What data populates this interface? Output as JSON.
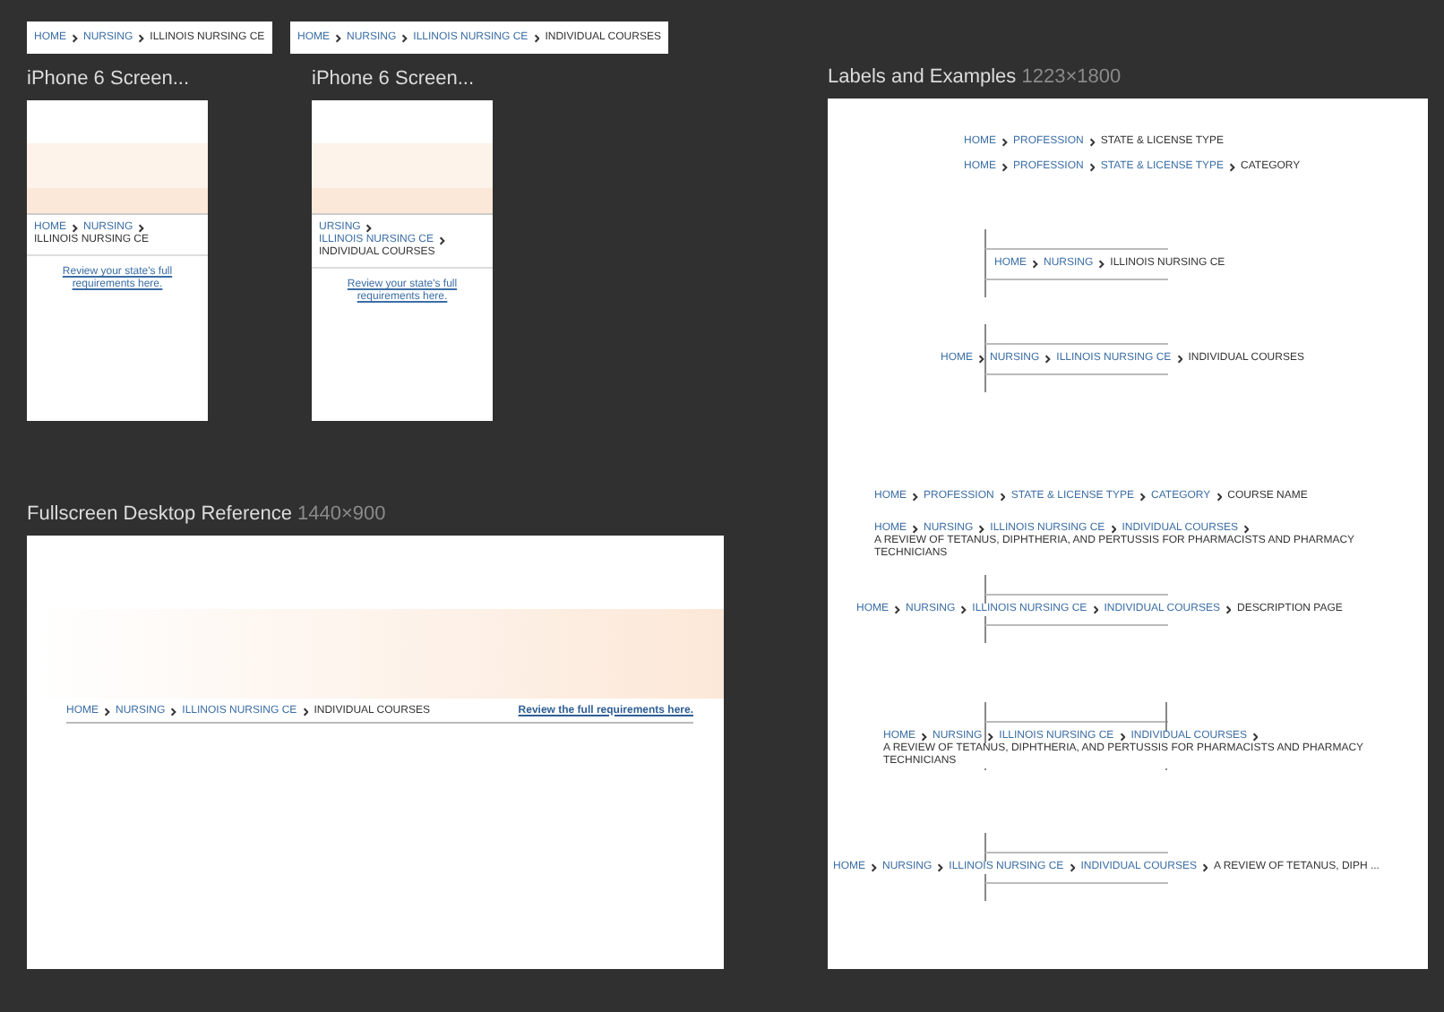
{
  "snippets": [
    {
      "breadcrumb": [
        {
          "label": "HOME",
          "current": false
        },
        {
          "label": "NURSING",
          "current": false
        },
        {
          "label": "ILLINOIS NURSING CE",
          "current": true
        }
      ]
    },
    {
      "breadcrumb": [
        {
          "label": "HOME",
          "current": false
        },
        {
          "label": "NURSING",
          "current": false
        },
        {
          "label": "ILLINOIS NURSING CE",
          "current": false
        },
        {
          "label": "INDIVIDUAL COURSES",
          "current": true
        }
      ]
    }
  ],
  "phones": [
    {
      "title": "iPhone 6 Screen...",
      "breadcrumb": [
        {
          "label": "HOME",
          "current": false
        },
        {
          "label": "NURSING",
          "current": false
        },
        {
          "label": "ILLINOIS NURSING CE",
          "current": true
        }
      ],
      "link": "Review your state's full requirements here."
    },
    {
      "title": "iPhone 6 Screen...",
      "breadcrumb": [
        {
          "label": "URSING",
          "current": false
        },
        {
          "label": "ILLINOIS NURSING CE",
          "current": false
        },
        {
          "label": "INDIVIDUAL COURSES",
          "current": true
        }
      ],
      "link": "Review your state's full requirements here."
    }
  ],
  "labels_board": {
    "title": "Labels and Examples",
    "size": "1223×1800",
    "examples": [
      {
        "kind": "plain",
        "breadcrumb": [
          {
            "label": "HOME",
            "current": false
          },
          {
            "label": "PROFESSION",
            "current": false
          },
          {
            "label": "STATE & LICENSE TYPE",
            "current": true
          }
        ]
      },
      {
        "kind": "plain",
        "breadcrumb": [
          {
            "label": "HOME",
            "current": false
          },
          {
            "label": "PROFESSION",
            "current": false
          },
          {
            "label": "STATE & LICENSE TYPE",
            "current": false
          },
          {
            "label": "CATEGORY",
            "current": true
          }
        ]
      },
      {
        "kind": "guide",
        "breadcrumb": [
          {
            "label": "HOME",
            "current": false
          },
          {
            "label": "NURSING",
            "current": false
          },
          {
            "label": "ILLINOIS NURSING CE",
            "current": true
          }
        ]
      },
      {
        "kind": "guide",
        "breadcrumb": [
          {
            "label": "HOME",
            "current": false
          },
          {
            "label": "NURSING",
            "current": false
          },
          {
            "label": "ILLINOIS NURSING CE",
            "current": false
          },
          {
            "label": "INDIVIDUAL COURSES",
            "current": true
          }
        ]
      },
      {
        "kind": "plain",
        "breadcrumb": [
          {
            "label": "HOME",
            "current": false
          },
          {
            "label": "PROFESSION",
            "current": false
          },
          {
            "label": "STATE & LICENSE TYPE",
            "current": false
          },
          {
            "label": "CATEGORY",
            "current": false
          },
          {
            "label": "COURSE NAME",
            "current": true
          }
        ]
      },
      {
        "kind": "plain",
        "breadcrumb": [
          {
            "label": "HOME",
            "current": false
          },
          {
            "label": "NURSING",
            "current": false
          },
          {
            "label": "ILLINOIS NURSING CE",
            "current": false
          },
          {
            "label": "INDIVIDUAL COURSES",
            "current": false
          },
          {
            "label": "A REVIEW OF TETANUS, DIPHTHERIA, AND PERTUSSIS FOR PHARMACISTS AND PHARMACY TECHNICIANS",
            "current": true
          }
        ]
      },
      {
        "kind": "guide",
        "breadcrumb": [
          {
            "label": "HOME",
            "current": false
          },
          {
            "label": "NURSING",
            "current": false
          },
          {
            "label": "ILLINOIS NURSING CE",
            "current": false
          },
          {
            "label": "INDIVIDUAL COURSES",
            "current": false
          },
          {
            "label": "DESCRIPTION PAGE",
            "current": true
          }
        ]
      },
      {
        "kind": "guide-both",
        "breadcrumb": [
          {
            "label": "HOME",
            "current": false
          },
          {
            "label": "NURSING",
            "current": false
          },
          {
            "label": "ILLINOIS NURSING CE",
            "current": false
          },
          {
            "label": "INDIVIDUAL COURSES",
            "current": false
          },
          {
            "label": "A REVIEW OF TETANUS, DIPHTHERIA, AND PERTUSSIS FOR PHARMACISTS AND PHARMACY TECHNICIANS",
            "current": true
          }
        ]
      },
      {
        "kind": "guide",
        "breadcrumb": [
          {
            "label": "HOME",
            "current": false
          },
          {
            "label": "NURSING",
            "current": false
          },
          {
            "label": "ILLINOIS NURSING CE",
            "current": false
          },
          {
            "label": "INDIVIDUAL COURSES",
            "current": false
          },
          {
            "label": "A REVIEW OF TETANUS, DIPH ...",
            "current": true
          }
        ]
      }
    ]
  },
  "desktop": {
    "title": "Fullscreen Desktop Reference",
    "size": "1440×900",
    "breadcrumb": [
      {
        "label": "HOME",
        "current": false
      },
      {
        "label": "NURSING",
        "current": false
      },
      {
        "label": "ILLINOIS NURSING CE",
        "current": false
      },
      {
        "label": "INDIVIDUAL COURSES",
        "current": true
      }
    ],
    "link": "Review the full requirements here."
  }
}
